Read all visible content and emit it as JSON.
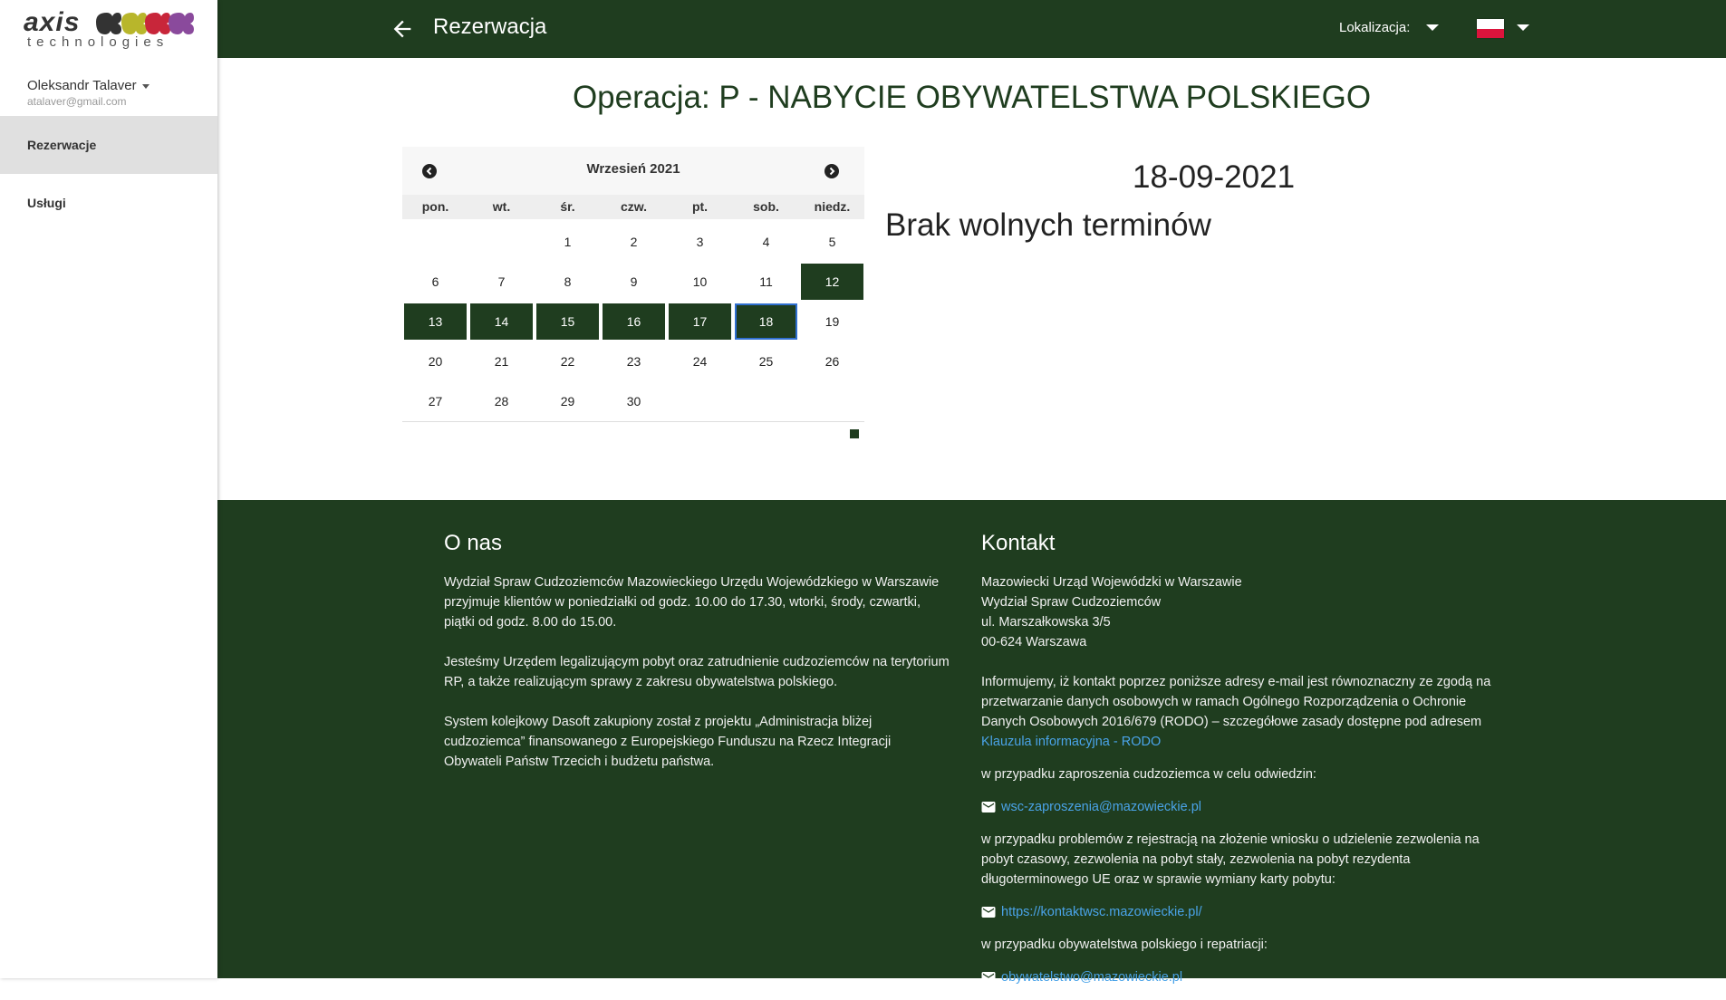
{
  "sidebar": {
    "logo_word": "axis",
    "logo_sub": "technologies",
    "user_name": "Oleksandr Talaver",
    "user_email": "atalaver@gmail.com",
    "items": [
      {
        "label": "Rezerwacje",
        "active": true
      },
      {
        "label": "Usługi",
        "active": false
      }
    ]
  },
  "topbar": {
    "title": "Rezerwacja",
    "location_label": "Lokalizacja:"
  },
  "main": {
    "operation_title": "Operacja: P - NABYCIE OBYWATELSTWA POLSKIEGO",
    "selected_date": "18-09-2021",
    "no_slots": "Brak wolnych terminów"
  },
  "calendar": {
    "month_label": "Wrzesień 2021",
    "weekdays": [
      "pon.",
      "wt.",
      "śr.",
      "czw.",
      "pt.",
      "sob.",
      "niedz."
    ],
    "first_weekday_index": 2,
    "days_in_month": 30,
    "available_days": [
      12,
      13,
      14,
      15,
      16,
      17,
      18
    ],
    "selected_day": 18
  },
  "footer": {
    "about": {
      "title": "O nas",
      "p1": "Wydział Spraw Cudzoziemców Mazowieckiego Urzędu Wojewódzkiego w Warszawie przyjmuje klientów w poniedziałki od godz. 10.00 do 17.30, wtorki, środy, czwartki, piątki od godz. 8.00 do 15.00.",
      "p2": "Jesteśmy Urzędem legalizującym pobyt oraz zatrudnienie cudzoziemców na terytorium RP, a także realizującym sprawy z zakresu obywatelstwa polskiego.",
      "p3": "System kolejkowy Dasoft zakupiony został z projektu „Administracja bliżej cudzoziemca” finansowanego z Europejskiego Funduszu na Rzecz Integracji Obywateli Państw Trzecich i budżetu państwa."
    },
    "contact": {
      "title": "Kontakt",
      "addr1": "Mazowiecki Urząd Wojewódzki w Warszawie",
      "addr2": "Wydział Spraw Cudzoziemców",
      "addr3": "ul. Marszałkowska 3/5",
      "addr4": "00-624 Warszawa",
      "rodo_text": "Informujemy, iż kontakt poprzez poniższe adresy e-mail jest równoznaczny ze zgodą na przetwarzanie danych osobowych w ramach Ogólnego Rozporządzenia o Ochronie Danych Osobowych 2016/679 (RODO) – szczegółowe zasady dostępne pod adresem",
      "rodo_link": "Klauzula informacyjna - RODO",
      "invite_text": "w przypadku zaproszenia cudzoziemca w celu odwiedzin:",
      "invite_email": "wsc-zaproszenia@mazowieckie.pl",
      "reg_text": "w przypadku problemów z rejestracją na złożenie wniosku o udzielenie zezwolenia na pobyt czasowy, zezwolenia na pobyt stały, zezwolenia na pobyt rezydenta długoterminowego UE oraz w sprawie wymiany karty pobytu:",
      "reg_link": "https://kontaktwsc.mazowieckie.pl/",
      "citizen_text": "w przypadku obywatelstwa polskiego i repatriacji:",
      "citizen_email": "obywatelstwo@mazowieckie.pl"
    }
  },
  "colors": {
    "primary": "#1f3d1f",
    "link": "#4aa3e8",
    "selected_border": "#2f6fd0"
  }
}
